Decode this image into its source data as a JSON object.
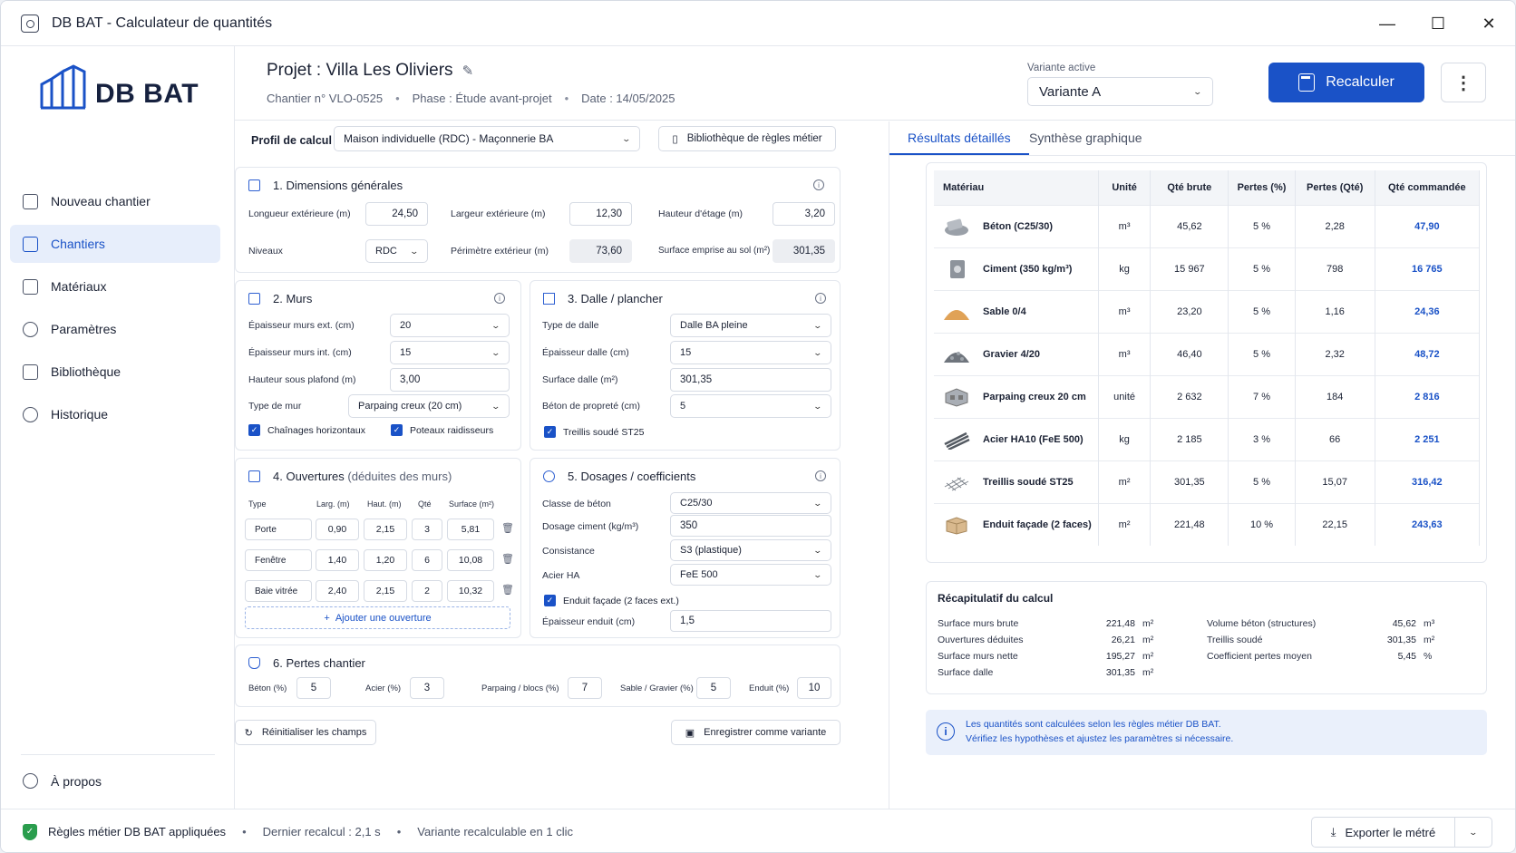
{
  "window": {
    "title": "DB BAT - Calculateur de quantités",
    "minimize": "—",
    "maximize": "☐",
    "close": "✕"
  },
  "sidebar": {
    "logo_text": "DB BAT",
    "items": [
      {
        "label": "Nouveau chantier",
        "icon": "new-site-icon"
      },
      {
        "label": "Chantiers",
        "icon": "sites-icon",
        "active": true
      },
      {
        "label": "Matériaux",
        "icon": "cube-icon"
      },
      {
        "label": "Paramètres",
        "icon": "gear-icon"
      },
      {
        "label": "Bibliothèque",
        "icon": "book-icon"
      },
      {
        "label": "Historique",
        "icon": "clock-icon"
      }
    ],
    "about": "À propos"
  },
  "header": {
    "title": "Projet : Villa Les Oliviers",
    "chantier": "Chantier n° VLO-0525",
    "phase": "Phase : Étude avant-projet",
    "date": "Date : 14/05/2025",
    "variant_label": "Variante active",
    "variant_value": "Variante A",
    "recalc_label": "Recalculer",
    "more": "⋮"
  },
  "profile": {
    "label": "Profil de calcul",
    "value": "Maison individuelle (RDC) - Maçonnerie BA",
    "library_button": "Bibliothèque de règles métier"
  },
  "dims": {
    "title": "1. Dimensions générales",
    "longueur_label": "Longueur extérieure (m)",
    "longueur": "24,50",
    "largeur_label": "Largeur extérieure (m)",
    "largeur": "12,30",
    "hauteur_label": "Hauteur d'étage (m)",
    "hauteur": "3,20",
    "niveaux_label": "Niveaux",
    "niveaux": "RDC",
    "perimetre_label": "Périmètre extérieur (m)",
    "perimetre": "73,60",
    "surface_label": "Surface emprise au sol (m²)",
    "surface": "301,35"
  },
  "murs": {
    "title": "2. Murs",
    "ep_ext_label": "Épaisseur murs ext. (cm)",
    "ep_ext": "20",
    "ep_int_label": "Épaisseur murs int. (cm)",
    "ep_int": "15",
    "hauteur_label": "Hauteur sous plafond (m)",
    "hauteur": "3,00",
    "type_label": "Type de mur",
    "type": "Parpaing creux (20 cm)",
    "chainages": "Chaînages horizontaux",
    "poteaux": "Poteaux raidisseurs"
  },
  "dalle": {
    "title": "3. Dalle / plancher",
    "type_label": "Type de dalle",
    "type": "Dalle BA pleine",
    "ep_label": "Épaisseur dalle (cm)",
    "ep": "15",
    "surface_label": "Surface dalle (m²)",
    "surface": "301,35",
    "proprete_label": "Béton de propreté (cm)",
    "proprete": "5",
    "treillis": "Treillis soudé ST25"
  },
  "ouvertures": {
    "title": "4. Ouvertures",
    "subtitle": "(déduites des murs)",
    "headers": [
      "Type",
      "Larg. (m)",
      "Haut. (m)",
      "Qté",
      "Surface (m²)"
    ],
    "rows": [
      {
        "type": "Porte",
        "larg": "0,90",
        "haut": "2,15",
        "qte": "3",
        "surface": "5,81"
      },
      {
        "type": "Fenêtre",
        "larg": "1,40",
        "haut": "1,20",
        "qte": "6",
        "surface": "10,08"
      },
      {
        "type": "Baie vitrée",
        "larg": "2,40",
        "haut": "2,15",
        "qte": "2",
        "surface": "10,32"
      }
    ],
    "add": "Ajouter une ouverture"
  },
  "dosages": {
    "title": "5. Dosages / coefficients",
    "classe_label": "Classe de béton",
    "classe": "C25/30",
    "ciment_label": "Dosage ciment (kg/m³)",
    "ciment": "350",
    "consistance_label": "Consistance",
    "consistance": "S3 (plastique)",
    "acier_label": "Acier HA",
    "acier": "FeE 500",
    "enduit_cb": "Enduit façade (2 faces ext.)",
    "ep_enduit_label": "Épaisseur enduit (cm)",
    "ep_enduit": "1,5"
  },
  "pertes": {
    "title": "6. Pertes chantier",
    "beton_label": "Béton (%)",
    "beton": "5",
    "acier_label": "Acier (%)",
    "acier": "3",
    "parpaing_label": "Parpaing / blocs (%)",
    "parpaing": "7",
    "sable_label": "Sable / Gravier (%)",
    "sable": "5",
    "enduit_label": "Enduit (%)",
    "enduit": "10"
  },
  "actions": {
    "reset": "Réinitialiser les champs",
    "save_variant": "Enregistrer comme variante"
  },
  "tabs": {
    "details": "Résultats détaillés",
    "synthese": "Synthèse graphique"
  },
  "results": {
    "headers": [
      "Matériau",
      "Unité",
      "Qté brute",
      "Pertes (%)",
      "Pertes (Qté)",
      "Qté commandée"
    ],
    "rows": [
      {
        "mat": "Béton (C25/30)",
        "unit": "m³",
        "brute": "45,62",
        "pct": "5 %",
        "pq": "2,28",
        "cmd": "47,90",
        "icon": "concrete-icon"
      },
      {
        "mat": "Ciment (350 kg/m³)",
        "unit": "kg",
        "brute": "15 967",
        "pct": "5 %",
        "pq": "798",
        "cmd": "16 765",
        "icon": "cement-bag-icon"
      },
      {
        "mat": "Sable 0/4",
        "unit": "m³",
        "brute": "23,20",
        "pct": "5 %",
        "pq": "1,16",
        "cmd": "24,36",
        "icon": "sand-pile-icon"
      },
      {
        "mat": "Gravier 4/20",
        "unit": "m³",
        "brute": "46,40",
        "pct": "5 %",
        "pq": "2,32",
        "cmd": "48,72",
        "icon": "gravel-pile-icon"
      },
      {
        "mat": "Parpaing creux 20 cm",
        "unit": "unité",
        "brute": "2 632",
        "pct": "7 %",
        "pq": "184",
        "cmd": "2 816",
        "icon": "block-icon"
      },
      {
        "mat": "Acier HA10 (FeE 500)",
        "unit": "kg",
        "brute": "2 185",
        "pct": "3 %",
        "pq": "66",
        "cmd": "2 251",
        "icon": "rebar-icon"
      },
      {
        "mat": "Treillis soudé ST25",
        "unit": "m²",
        "brute": "301,35",
        "pct": "5 %",
        "pq": "15,07",
        "cmd": "316,42",
        "icon": "mesh-icon"
      },
      {
        "mat": "Enduit façade (2 faces)",
        "unit": "m²",
        "brute": "221,48",
        "pct": "10 %",
        "pq": "22,15",
        "cmd": "243,63",
        "icon": "render-box-icon"
      }
    ]
  },
  "recap": {
    "title": "Récapitulatif du calcul",
    "left": [
      {
        "label": "Surface murs brute",
        "value": "221,48",
        "unit": "m²"
      },
      {
        "label": "Ouvertures déduites",
        "value": "26,21",
        "unit": "m²"
      },
      {
        "label": "Surface murs nette",
        "value": "195,27",
        "unit": "m²"
      },
      {
        "label": "Surface dalle",
        "value": "301,35",
        "unit": "m²"
      }
    ],
    "right": [
      {
        "label": "Volume béton (structures)",
        "value": "45,62",
        "unit": "m³"
      },
      {
        "label": "Treillis soudé",
        "value": "301,35",
        "unit": "m²"
      },
      {
        "label": "Coefficient pertes moyen",
        "value": "5,45",
        "unit": "%"
      }
    ]
  },
  "notice": {
    "line1": "Les quantités sont calculées selon les règles métier DB BAT.",
    "line2": "Vérifiez les hypothèses et ajustez les paramètres si nécessaire."
  },
  "status": {
    "rules": "Règles métier DB BAT appliquées",
    "last": "Dernier recalcul : 2,1 s",
    "variant": "Variante recalculable en 1 clic",
    "export": "Exporter le métré"
  }
}
